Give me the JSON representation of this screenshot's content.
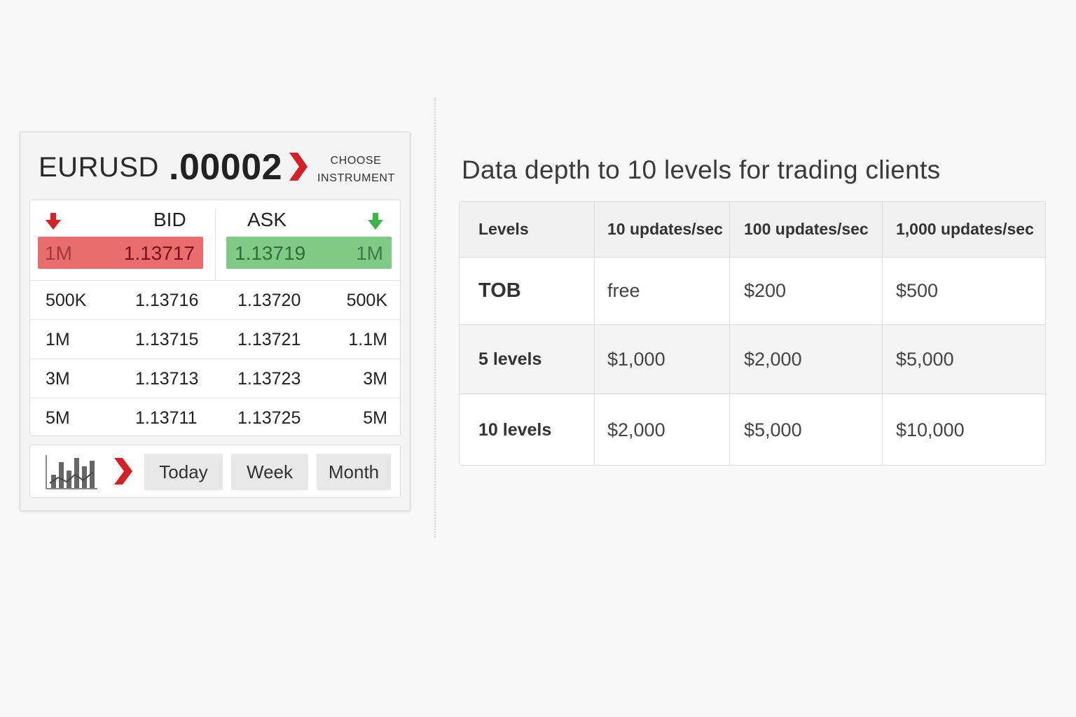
{
  "widget": {
    "symbol": "EURUSD",
    "spread": ".00002",
    "choose_line1": "CHOOSE",
    "choose_line2": "INSTRUMENT",
    "bid_label": "BID",
    "ask_label": "ASK",
    "best_bid": {
      "size": "1M",
      "price": "1.13717"
    },
    "best_ask": {
      "price": "1.13719",
      "size": "1M"
    },
    "depth": [
      {
        "bid_size": "500K",
        "bid_price": "1.13716",
        "ask_price": "1.13720",
        "ask_size": "500K"
      },
      {
        "bid_size": "1M",
        "bid_price": "1.13715",
        "ask_price": "1.13721",
        "ask_size": "1.1M"
      },
      {
        "bid_size": "3M",
        "bid_price": "1.13713",
        "ask_price": "1.13723",
        "ask_size": "3M"
      },
      {
        "bid_size": "5M",
        "bid_price": "1.13711",
        "ask_price": "1.13725",
        "ask_size": "5M"
      }
    ],
    "periods": {
      "today": "Today",
      "week": "Week",
      "month": "Month"
    },
    "icons": {
      "chevron": "chevron-right-icon",
      "bid_arrow": "arrow-down-icon",
      "ask_arrow": "arrow-down-icon",
      "chart": "bar-chart-icon"
    },
    "colors": {
      "bid_bg": "#e86d6d",
      "ask_bg": "#7fca85",
      "accent_red": "#d42027",
      "accent_green": "#3ab54a"
    }
  },
  "pricing": {
    "title": "Data depth to 10 levels for trading clients",
    "headers": [
      "Levels",
      "10 updates/sec",
      "100 updates/sec",
      "1,000 updates/sec"
    ],
    "rows": [
      {
        "level": "TOB",
        "values": [
          "free",
          "$200",
          "$500"
        ]
      },
      {
        "level": "5 levels",
        "values": [
          "$1,000",
          "$2,000",
          "$5,000"
        ]
      },
      {
        "level": "10 levels",
        "values": [
          "$2,000",
          "$5,000",
          "$10,000"
        ]
      }
    ]
  }
}
